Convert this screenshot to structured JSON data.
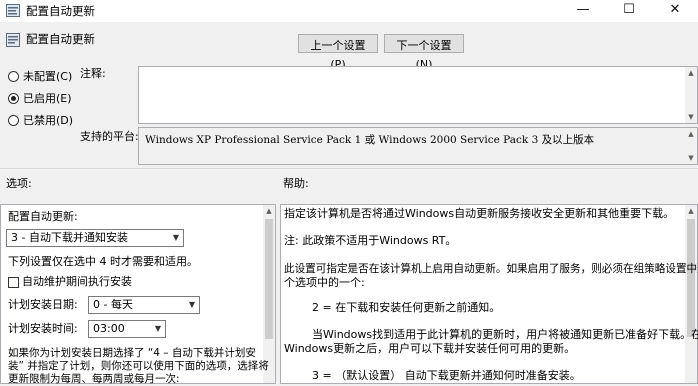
{
  "window": {
    "title": "配置自动更新",
    "minimize": "—",
    "maximize": "☐",
    "close": "✕"
  },
  "header": {
    "title": "配置自动更新"
  },
  "nav": {
    "prev": "上一个设置(P)",
    "next": "下一个设置(N)"
  },
  "state": {
    "not_configured": "未配置(C)",
    "enabled": "已启用(E)",
    "disabled": "已禁用(D)",
    "selected": "enabled"
  },
  "comment": {
    "label": "注释:",
    "value": ""
  },
  "platform": {
    "label": "支持的平台:",
    "value": "Windows XP Professional Service Pack 1 或 Windows 2000 Service Pack 3 及以上版本"
  },
  "options": {
    "header": "选项:",
    "configure_label": "配置自动更新:",
    "configure_value": "3 - 自动下载并通知安装",
    "note": "下列设置仅在选中 4 时才需要和适用。",
    "maintenance_label": "自动维护期间执行安装",
    "day_label": "计划安装日期:",
    "day_value": "0 - 每天",
    "time_label": "计划安装时间:",
    "time_value": "03:00",
    "footer_1": "如果你为计划安装日期选择了 “4 – 自动下载并计划安",
    "footer_2": "装” 并指定了计划，则你还可以使用下面的选项，选择将",
    "footer_3": "更新限制为每周、每两周或每月一次:"
  },
  "help": {
    "header": "帮助:",
    "lines": [
      "指定该计算机是否将通过Windows自动更新服务接收安全更新和其他重要下载。",
      "注: 此政策不适用于Windows RT。",
      "此设置可指定是否在该计算机上启用自动更新。如果启用了服务，则必须在组策略设置中选择四",
      "个选项中的一个:",
      "2 = 在下载和安装任何更新之前通知。",
      "当Windows找到适用于此计算机的更新时，用户将被通知更新已准备好下载。在进入",
      "Windows更新之后，用户可以下载并安装任何可用的更新。",
      "3 = （默认设置） 自动下载更新并通知何时准备安装。"
    ]
  }
}
